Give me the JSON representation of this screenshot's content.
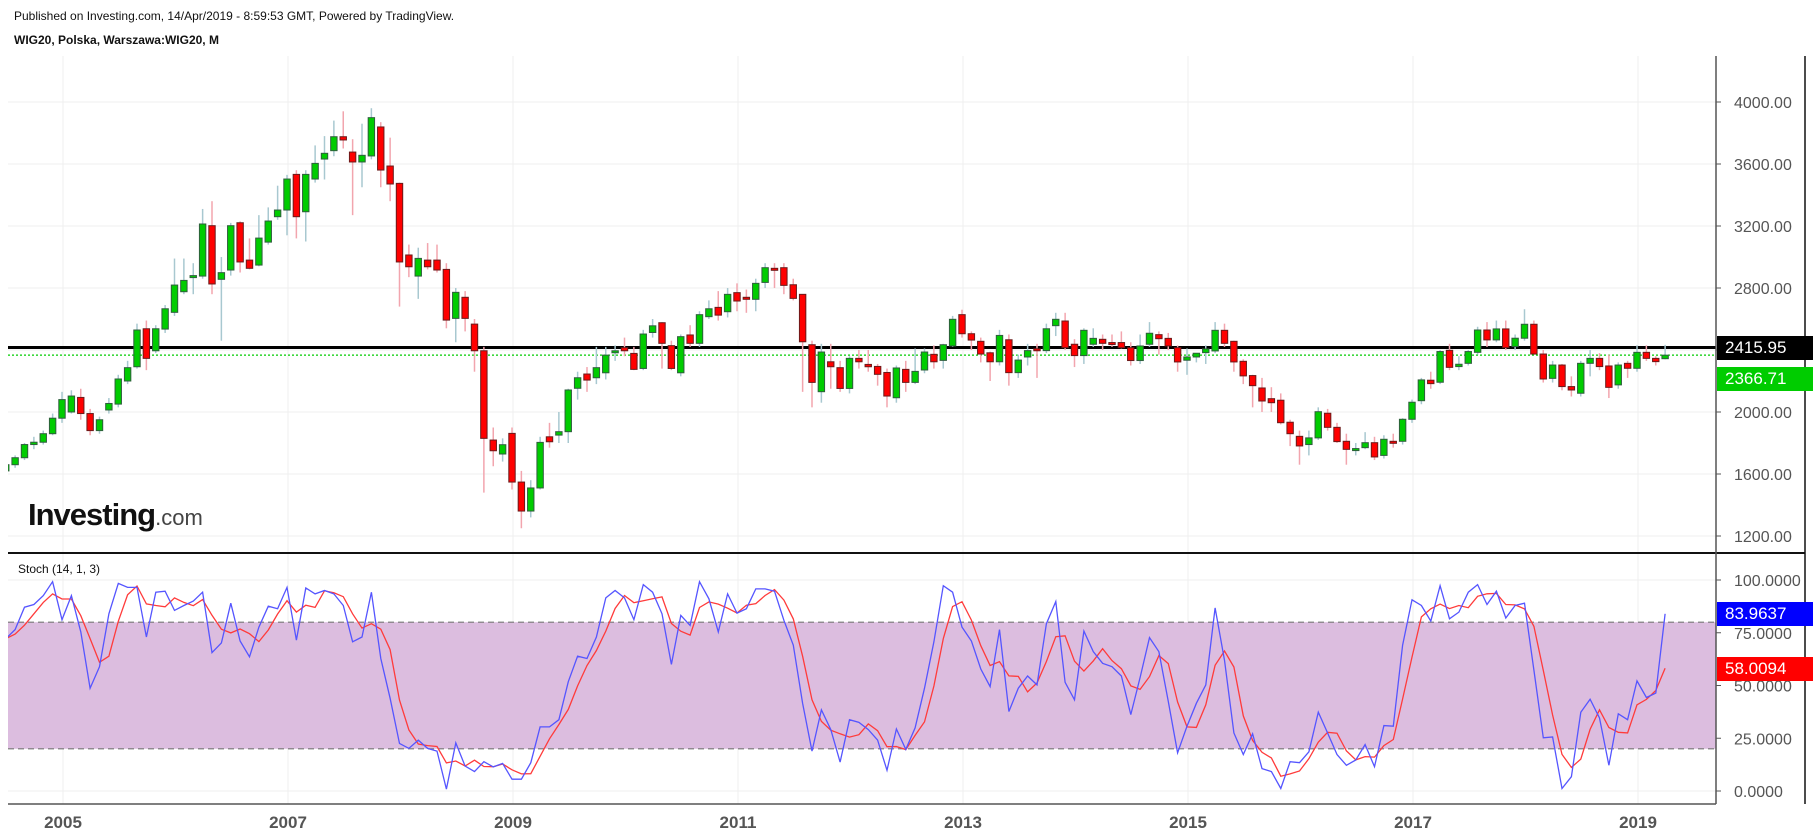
{
  "header": {
    "published": "Published on Investing.com, 14/Apr/2019 - 8:59:53 GMT, Powered by TradingView.",
    "symbol": "WIG20, Polska, Warszawa:WIG20, M"
  },
  "logo": {
    "main": "Investing",
    "domain": ".com"
  },
  "colors": {
    "up": "#00cc00",
    "down": "#ff0000",
    "up_border": "#2e5e3c",
    "down_border": "#6a1a1a",
    "up_wick": "#a8c8d0",
    "down_wick": "#f2a5ae",
    "k_line": "#5555ff",
    "d_line": "#ff3b3b",
    "band": "#dcbddf",
    "last_price": "#00cc00",
    "hline": "#000000"
  },
  "chart_data": [
    {
      "type": "candlestick",
      "title": "WIG20, Polska, Warszawa:WIG20, M",
      "start": "2004-07",
      "interval": "1M",
      "ylim": [
        1000,
        4250
      ],
      "yticks": [
        "1200.00",
        "1600.00",
        "2000.00",
        "2400.00",
        "2800.00",
        "3200.00",
        "3600.00",
        "4000.00"
      ],
      "ytick_values": [
        1200,
        1600,
        2000,
        2400,
        2800,
        3200,
        3600,
        4000
      ],
      "xticks": [
        "2005",
        "2007",
        "2009",
        "2011",
        "2013",
        "2015",
        "2017",
        "2019"
      ],
      "horizontal_line": {
        "value": 2415.95,
        "label": "2415.95"
      },
      "last_price": {
        "value": 2366.71,
        "label": "2366.71"
      },
      "ohlc": [
        [
          1620,
          1690,
          1600,
          1660
        ],
        [
          1660,
          1720,
          1640,
          1705
        ],
        [
          1705,
          1800,
          1690,
          1790
        ],
        [
          1790,
          1840,
          1760,
          1805
        ],
        [
          1805,
          1880,
          1790,
          1860
        ],
        [
          1860,
          1990,
          1850,
          1960
        ],
        [
          1960,
          2130,
          1930,
          2080
        ],
        [
          2000,
          2140,
          1990,
          2103
        ],
        [
          2094,
          2150,
          1950,
          1990
        ],
        [
          1990,
          2020,
          1850,
          1880
        ],
        [
          1880,
          1970,
          1860,
          1950
        ],
        [
          2013,
          2090,
          1990,
          2055
        ],
        [
          2051,
          2240,
          2030,
          2213
        ],
        [
          2200,
          2330,
          2180,
          2286
        ],
        [
          2292,
          2570,
          2280,
          2529
        ],
        [
          2537,
          2590,
          2270,
          2346
        ],
        [
          2395,
          2560,
          2380,
          2537
        ],
        [
          2535,
          2690,
          2510,
          2666
        ],
        [
          2643,
          2990,
          2620,
          2819
        ],
        [
          2776,
          2990,
          2760,
          2849
        ],
        [
          2868,
          2960,
          2760,
          2880
        ],
        [
          2877,
          3310,
          2860,
          3213
        ],
        [
          3202,
          3360,
          2760,
          2826
        ],
        [
          2856,
          3000,
          2460,
          2899
        ],
        [
          2916,
          3220,
          2880,
          3202
        ],
        [
          3221,
          3230,
          2900,
          2968
        ],
        [
          2980,
          3120,
          2920,
          2927
        ],
        [
          2948,
          3270,
          2940,
          3122
        ],
        [
          3096,
          3320,
          3080,
          3232
        ],
        [
          3260,
          3460,
          3240,
          3303
        ],
        [
          3303,
          3530,
          3140,
          3503
        ],
        [
          3533,
          3560,
          3120,
          3260
        ],
        [
          3292,
          3560,
          3100,
          3533
        ],
        [
          3503,
          3720,
          3480,
          3604
        ],
        [
          3632,
          3780,
          3500,
          3669
        ],
        [
          3686,
          3880,
          3650,
          3776
        ],
        [
          3776,
          3940,
          3700,
          3755
        ],
        [
          3677,
          3760,
          3270,
          3613
        ],
        [
          3613,
          3860,
          3450,
          3656
        ],
        [
          3652,
          3960,
          3630,
          3899
        ],
        [
          3839,
          3870,
          3450,
          3561
        ],
        [
          3587,
          3770,
          3360,
          3471
        ],
        [
          3475,
          3480,
          2680,
          2968
        ],
        [
          3013,
          3080,
          2870,
          2937
        ],
        [
          2877,
          3060,
          2730,
          2991
        ],
        [
          2980,
          3090,
          2920,
          2937
        ],
        [
          2980,
          3080,
          2900,
          2916
        ],
        [
          2920,
          2960,
          2540,
          2593
        ],
        [
          2604,
          2800,
          2450,
          2772
        ],
        [
          2740,
          2780,
          2520,
          2604
        ],
        [
          2567,
          2600,
          2260,
          2395
        ],
        [
          2395,
          2420,
          1480,
          1830
        ],
        [
          1819,
          1900,
          1650,
          1750
        ],
        [
          1729,
          1830,
          1680,
          1789
        ],
        [
          1862,
          1900,
          1500,
          1548
        ],
        [
          1548,
          1620,
          1250,
          1361
        ],
        [
          1361,
          1560,
          1320,
          1510
        ],
        [
          1510,
          1840,
          1500,
          1804
        ],
        [
          1840,
          1930,
          1770,
          1808
        ],
        [
          1851,
          2000,
          1800,
          1873
        ],
        [
          1873,
          2150,
          1800,
          2142
        ],
        [
          2153,
          2260,
          2080,
          2221
        ],
        [
          2245,
          2290,
          2130,
          2206
        ],
        [
          2221,
          2420,
          2180,
          2286
        ],
        [
          2253,
          2420,
          2210,
          2367
        ],
        [
          2392,
          2430,
          2330,
          2395
        ],
        [
          2415,
          2480,
          2360,
          2395
        ],
        [
          2378,
          2420,
          2270,
          2275
        ],
        [
          2281,
          2530,
          2270,
          2503
        ],
        [
          2513,
          2600,
          2480,
          2556
        ],
        [
          2576,
          2580,
          2280,
          2443
        ],
        [
          2428,
          2460,
          2270,
          2281
        ],
        [
          2253,
          2500,
          2230,
          2486
        ],
        [
          2497,
          2560,
          2420,
          2443
        ],
        [
          2443,
          2650,
          2420,
          2628
        ],
        [
          2615,
          2720,
          2600,
          2666
        ],
        [
          2675,
          2780,
          2590,
          2625
        ],
        [
          2647,
          2800,
          2610,
          2759
        ],
        [
          2770,
          2830,
          2650,
          2716
        ],
        [
          2740,
          2790,
          2640,
          2728
        ],
        [
          2727,
          2860,
          2650,
          2830
        ],
        [
          2836,
          2960,
          2800,
          2931
        ],
        [
          2927,
          2960,
          2800,
          2916
        ],
        [
          2931,
          2960,
          2760,
          2817
        ],
        [
          2821,
          2860,
          2720,
          2733
        ],
        [
          2759,
          2760,
          2130,
          2453
        ],
        [
          2434,
          2460,
          2030,
          2191
        ],
        [
          2131,
          2440,
          2060,
          2387
        ],
        [
          2324,
          2440,
          2150,
          2292
        ],
        [
          2286,
          2330,
          2130,
          2152
        ],
        [
          2152,
          2360,
          2120,
          2346
        ],
        [
          2346,
          2400,
          2280,
          2324
        ],
        [
          2307,
          2400,
          2260,
          2292
        ],
        [
          2294,
          2310,
          2170,
          2243
        ],
        [
          2255,
          2280,
          2030,
          2103
        ],
        [
          2092,
          2300,
          2060,
          2284
        ],
        [
          2275,
          2330,
          2130,
          2191
        ],
        [
          2191,
          2410,
          2180,
          2262
        ],
        [
          2271,
          2410,
          2250,
          2387
        ],
        [
          2372,
          2430,
          2280,
          2324
        ],
        [
          2333,
          2440,
          2280,
          2434
        ],
        [
          2426,
          2620,
          2420,
          2598
        ],
        [
          2628,
          2660,
          2480,
          2505
        ],
        [
          2505,
          2520,
          2400,
          2464
        ],
        [
          2456,
          2480,
          2320,
          2374
        ],
        [
          2382,
          2390,
          2200,
          2324
        ],
        [
          2324,
          2530,
          2300,
          2494
        ],
        [
          2466,
          2500,
          2170,
          2254
        ],
        [
          2254,
          2370,
          2220,
          2335
        ],
        [
          2355,
          2440,
          2300,
          2396
        ],
        [
          2408,
          2440,
          2220,
          2400
        ],
        [
          2396,
          2570,
          2380,
          2537
        ],
        [
          2557,
          2640,
          2490,
          2598
        ],
        [
          2587,
          2640,
          2400,
          2415
        ],
        [
          2437,
          2470,
          2290,
          2364
        ],
        [
          2364,
          2540,
          2310,
          2527
        ],
        [
          2437,
          2540,
          2420,
          2475
        ],
        [
          2469,
          2500,
          2400,
          2443
        ],
        [
          2448,
          2500,
          2420,
          2437
        ],
        [
          2448,
          2520,
          2410,
          2415
        ],
        [
          2415,
          2450,
          2300,
          2332
        ],
        [
          2332,
          2500,
          2310,
          2426
        ],
        [
          2437,
          2580,
          2420,
          2508
        ],
        [
          2499,
          2520,
          2370,
          2473
        ],
        [
          2475,
          2510,
          2400,
          2426
        ],
        [
          2415,
          2430,
          2260,
          2323
        ],
        [
          2334,
          2410,
          2240,
          2355
        ],
        [
          2355,
          2380,
          2320,
          2379
        ],
        [
          2383,
          2430,
          2310,
          2407
        ],
        [
          2394,
          2580,
          2380,
          2527
        ],
        [
          2527,
          2570,
          2420,
          2443
        ],
        [
          2456,
          2460,
          2260,
          2323
        ],
        [
          2327,
          2340,
          2180,
          2233
        ],
        [
          2235,
          2240,
          2030,
          2170
        ],
        [
          2155,
          2220,
          2000,
          2071
        ],
        [
          2086,
          2160,
          2000,
          2060
        ],
        [
          2076,
          2120,
          1920,
          1931
        ],
        [
          1934,
          1950,
          1780,
          1860
        ],
        [
          1843,
          1880,
          1660,
          1781
        ],
        [
          1790,
          1880,
          1720,
          1833
        ],
        [
          1833,
          2030,
          1820,
          2002
        ],
        [
          1992,
          2020,
          1880,
          1901
        ],
        [
          1901,
          1930,
          1800,
          1809
        ],
        [
          1811,
          1860,
          1660,
          1759
        ],
        [
          1759,
          1800,
          1720,
          1764
        ],
        [
          1770,
          1870,
          1760,
          1802
        ],
        [
          1802,
          1840,
          1690,
          1710
        ],
        [
          1720,
          1850,
          1700,
          1824
        ],
        [
          1811,
          1860,
          1770,
          1798
        ],
        [
          1811,
          1960,
          1790,
          1953
        ],
        [
          1953,
          2080,
          1930,
          2063
        ],
        [
          2073,
          2220,
          2050,
          2207
        ],
        [
          2205,
          2260,
          2150,
          2183
        ],
        [
          2192,
          2400,
          2180,
          2390
        ],
        [
          2398,
          2440,
          2270,
          2288
        ],
        [
          2293,
          2360,
          2270,
          2308
        ],
        [
          2314,
          2400,
          2300,
          2390
        ],
        [
          2385,
          2550,
          2370,
          2529
        ],
        [
          2529,
          2580,
          2420,
          2465
        ],
        [
          2465,
          2590,
          2450,
          2536
        ],
        [
          2536,
          2590,
          2400,
          2415
        ],
        [
          2422,
          2500,
          2400,
          2476
        ],
        [
          2476,
          2663,
          2460,
          2566
        ],
        [
          2566,
          2590,
          2370,
          2374
        ],
        [
          2374,
          2400,
          2190,
          2213
        ],
        [
          2217,
          2330,
          2190,
          2303
        ],
        [
          2303,
          2310,
          2140,
          2164
        ],
        [
          2164,
          2230,
          2100,
          2142
        ],
        [
          2121,
          2330,
          2100,
          2314
        ],
        [
          2314,
          2400,
          2230,
          2346
        ],
        [
          2346,
          2380,
          2270,
          2293
        ],
        [
          2297,
          2370,
          2090,
          2159
        ],
        [
          2175,
          2320,
          2150,
          2303
        ],
        [
          2314,
          2330,
          2220,
          2282
        ],
        [
          2282,
          2430,
          2260,
          2385
        ],
        [
          2385,
          2430,
          2330,
          2346
        ],
        [
          2346,
          2360,
          2300,
          2325
        ],
        [
          2344,
          2433,
          2340,
          2366.71
        ]
      ]
    },
    {
      "type": "line",
      "title": "Stoch (14, 1, 3)",
      "start": "2004-07",
      "ylim": [
        -6,
        112
      ],
      "yticks": [
        "0.0000",
        "25.0000",
        "50.0000",
        "75.0000",
        "100.0000"
      ],
      "ytick_values": [
        0,
        25,
        50,
        75,
        100
      ],
      "band": [
        20,
        80
      ],
      "d_smoothing": 3,
      "last_k": {
        "value": 83.9637,
        "label": "83.9637"
      },
      "last_d": {
        "value": 58.0094,
        "label": "58.0094"
      },
      "k": [
        72.2,
        76.5,
        87.1,
        88.4,
        92.6,
        99.2,
        81.2,
        92.6,
        75.4,
        48.7,
        58.9,
        84.0,
        98.4,
        96.5,
        96.5,
        73.0,
        94.2,
        94.7,
        85.6,
        87.9,
        90.0,
        94.2,
        65.6,
        70.2,
        89.0,
        71.1,
        63.6,
        77.7,
        87.6,
        86.4,
        96.5,
        71.5,
        96.2,
        93.4,
        95.0,
        93.4,
        87.9,
        70.7,
        73.0,
        94.2,
        62.8,
        44.0,
        22.5,
        20.2,
        24.1,
        20.2,
        18.9,
        0.9,
        22.8,
        11.8,
        9.2,
        13.9,
        11.4,
        13.1,
        5.6,
        5.6,
        13.4,
        30.4,
        30.4,
        33.8,
        51.8,
        63.9,
        62.8,
        73.0,
        91.5,
        95.0,
        91.5,
        81.2,
        97.8,
        94.2,
        84.0,
        60.0,
        83.2,
        78.5,
        99.2,
        91.1,
        75.4,
        93.4,
        84.3,
        86.4,
        95.8,
        95.8,
        94.7,
        80.9,
        69.1,
        41.6,
        18.9,
        38.5,
        29.1,
        13.7,
        33.8,
        32.5,
        29.1,
        24.1,
        9.8,
        29.4,
        19.7,
        29.9,
        48.7,
        70.7,
        97.3,
        94.2,
        77.7,
        71.1,
        57.8,
        49.5,
        76.5,
        37.7,
        48.7,
        54.5,
        50.3,
        79.3,
        89.8,
        51.5,
        43.2,
        75.8,
        66.0,
        60.5,
        58.9,
        54.5,
        36.2,
        53.8,
        72.7,
        66.0,
        42.4,
        18.1,
        30.7,
        41.6,
        50.3,
        86.8,
        62.0,
        27.5,
        17.3,
        27.1,
        10.6,
        9.2,
        1.2,
        13.9,
        13.4,
        18.6,
        37.4,
        27.5,
        17.3,
        12.2,
        14.7,
        22.0,
        11.5,
        31.0,
        30.7,
        69.1,
        90.6,
        87.9,
        80.5,
        97.3,
        81.6,
        84.8,
        94.2,
        97.8,
        88.4,
        94.7,
        82.0,
        87.9,
        89.0,
        57.3,
        25.2,
        25.6,
        1.2,
        6.8,
        37.3,
        43.5,
        34.6,
        12.2,
        36.6,
        33.8,
        52.2,
        44.3,
        46.4,
        83.9637
      ]
    }
  ]
}
